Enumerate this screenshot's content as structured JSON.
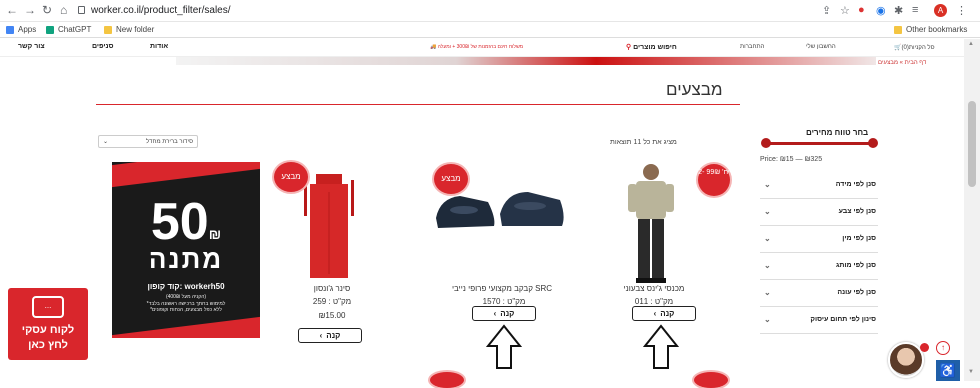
{
  "browser": {
    "url": "worker.co.il/product_filter/sales/",
    "profile_initial": "A",
    "bookmarks": [
      "Apps",
      "ChatGPT",
      "New folder"
    ],
    "other_bookmarks": "Other bookmarks"
  },
  "site_nav": {
    "items": [
      "צור קשר",
      "סניפים",
      "אודות"
    ],
    "promo": "משלוח חינם בהזמנות של 300₪ + ומעלה",
    "search_label": "חיפוש מוצרים",
    "login": "התחברות",
    "account": "החשבון שלי",
    "cart": "סל הקניות(0)"
  },
  "breadcrumb": "דף הבית » מבצעים",
  "page_title": "מבצעים",
  "results_text": "מציג את כל 11 תוצאות",
  "sort_label": "סידור ברירת מחדל",
  "filters": {
    "price_title": "בחר טווח מחירים",
    "price_range": "Price: ₪15 — ₪325",
    "groups": [
      "סנן לפי מידה",
      "סנן לפי צבע",
      "סנן לפי מין",
      "סנן לפי מותג",
      "סנן לפי עונה",
      "סינון לפי תחום עיסוק"
    ]
  },
  "products": [
    {
      "name": "מכנסי ג'ינס צבעוני",
      "sku": "מק\"ט : 011",
      "badge": "2- יח' 99₪",
      "buy": "קנה"
    },
    {
      "name": "קבקב מקצועי פרופי נייבי SRC",
      "sku": "מק\"ט : 1570",
      "badge": "מבצע",
      "buy": "קנה"
    },
    {
      "name": "סינר ג'ונסון",
      "sku": "מק\"ט : 259",
      "price": "₪15.00",
      "badge": "מבצע",
      "buy": "קנה"
    }
  ],
  "coupon": {
    "amount": "50",
    "currency": "₪",
    "word": "מתנה",
    "code": "קוד קופון: workerh50",
    "fine1": "(הקניה מעל 400₪)",
    "fine2": "*למימוש בחתך ברכישה ראשונה בלבד",
    "fine3": "*ללא כפל מבצעים, הנחות וקופונים"
  },
  "b2b": {
    "line1": "לקוח עסקי",
    "line2": "לחץ כאן",
    "chat": "..."
  },
  "colors": {
    "brand": "#d9262c",
    "dark": "#1a1a1a"
  }
}
